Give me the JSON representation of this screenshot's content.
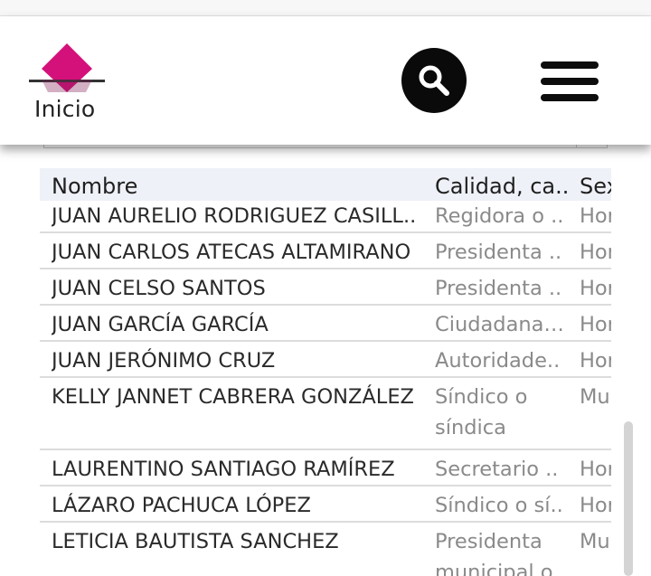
{
  "header": {
    "logo_label": "Inicio",
    "accent_color": "#d4117b",
    "search_icon": "search-icon",
    "menu_icon": "hamburger-menu-icon"
  },
  "table": {
    "columns": [
      "Nombre",
      "Calidad, ca..",
      "Sex"
    ],
    "rows": [
      {
        "name": "JUAN AURELIO RODRIGUEZ CASILL..",
        "calidad": "Regidora o ..",
        "sexo": "Hor"
      },
      {
        "name": "JUAN CARLOS ATECAS ALTAMIRANO",
        "calidad": "Presidenta ..",
        "sexo": "Hor"
      },
      {
        "name": "JUAN CELSO SANTOS",
        "calidad": "Presidenta ..",
        "sexo": "Hor"
      },
      {
        "name": "JUAN GARCÍA GARCÍA",
        "calidad": "Ciudadana (..",
        "sexo": "Hor"
      },
      {
        "name": "JUAN JERÓNIMO CRUZ",
        "calidad": "Autoridade..",
        "sexo": "Hor"
      },
      {
        "name": "KELLY JANNET CABRERA GONZÁLEZ",
        "calidad": "Síndico o síndica",
        "sexo": "Mu"
      },
      {
        "name": "LAURENTINO SANTIAGO RAMÍREZ",
        "calidad": "Secretario ..",
        "sexo": "Hor"
      },
      {
        "name": "LÁZARO PACHUCA LÓPEZ",
        "calidad": "Síndico o sí..",
        "sexo": "Hor"
      },
      {
        "name": "LETICIA BAUTISTA SANCHEZ",
        "calidad": "Presidenta municipal o",
        "sexo": "Mu"
      }
    ]
  }
}
